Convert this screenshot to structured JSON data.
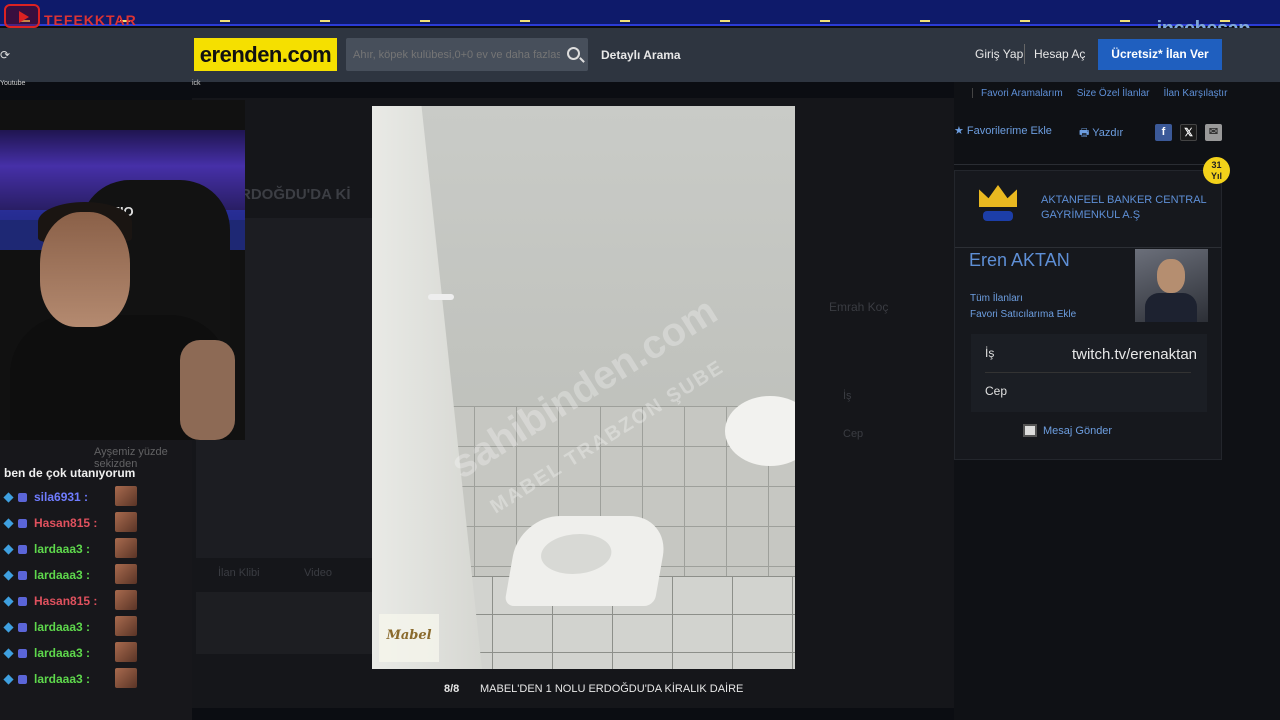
{
  "stream": {
    "brand": "TEFEKKTAR",
    "watermark_site": "incehesap",
    "watermark_site_suffix": ".com",
    "browser_left_label": "Youtube",
    "bookmarks_label": "ick"
  },
  "header": {
    "logo": "erenden.com",
    "search_placeholder": "Ahır, köpek kulübesi,0+0 ev ve daha fazlası",
    "advanced_search": "Detaylı Arama",
    "login": "Giriş Yap",
    "register": "Hesap Aç",
    "post_ad": "Ücretsiz* İlan Ver"
  },
  "top_links": [
    "Favori Aramalarım",
    "Size Özel İlanlar",
    "İlan Karşılaştır"
  ],
  "actions": {
    "favorite": "Favorilerime Ekle",
    "print": "Yazdır"
  },
  "background_page": {
    "title_fragment": "RDOĞDU'DA Kİ",
    "agent_name": "Emrah Koç",
    "media_photo": "İlan Klibi",
    "media_video": "Video",
    "phone_label_is": "İş",
    "phone_label_cep": "Cep"
  },
  "viewer": {
    "counter": "8/8",
    "title": "MABEL'DEN 1 NOLU ERDOĞDU'DA KİRALIK DAİRE",
    "watermark": "sahibinden.com",
    "watermark_branch": "MABEL TRABZON ŞUBE",
    "logo": "Mabel"
  },
  "store": {
    "years_badge_number": "31",
    "years_badge_unit": "Yıl",
    "name_line1": "AKTANFEEL BANKER CENTRAL",
    "name_line2": "GAYRİMENKUL A.Ş",
    "seller_name": "Eren AKTAN",
    "all_listings": "Tüm İlanları",
    "add_favorite_seller": "Favori Satıcılarıma Ekle",
    "phone_work_label": "İş",
    "phone_work_value": "twitch.tv/erenaktan",
    "phone_mobile_label": "Cep",
    "send_message": "Mesaj Gönder"
  },
  "webcam": {
    "chair_brand": "ZIO"
  },
  "chat": {
    "partial_line": "Ayşemiz yüzde sekizden",
    "message": "ben de çok utanıyorum",
    "rows": [
      {
        "user": "sila6931",
        "color": "#6f7cff"
      },
      {
        "user": "Hasan815",
        "color": "#e0515e"
      },
      {
        "user": "lardaaa3",
        "color": "#5ed84c"
      },
      {
        "user": "lardaaa3",
        "color": "#5ed84c"
      },
      {
        "user": "Hasan815",
        "color": "#e0515e"
      },
      {
        "user": "lardaaa3",
        "color": "#5ed84c"
      },
      {
        "user": "lardaaa3",
        "color": "#5ed84c"
      },
      {
        "user": "lardaaa3",
        "color": "#5ed84c"
      }
    ]
  },
  "colors": {
    "accent_blue": "#1f5fbf",
    "link_blue": "#5e8fd6",
    "logo_yellow": "#f5e000"
  }
}
